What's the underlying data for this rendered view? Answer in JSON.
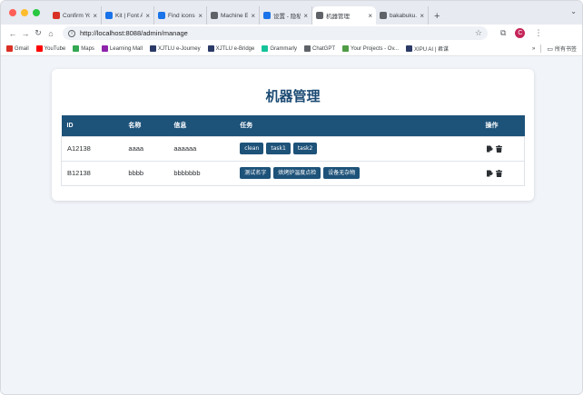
{
  "browser": {
    "tabs": [
      {
        "title": "Confirm Your I",
        "favicon": "gmail-icon",
        "color": "#d93025",
        "active": false
      },
      {
        "title": "Kit | Font Awe",
        "favicon": "fontawesome-icon",
        "color": "#1a73e8",
        "active": false
      },
      {
        "title": "Find icons wit",
        "favicon": "fontawesome-icon",
        "color": "#1a73e8",
        "active": false
      },
      {
        "title": "Machine Edit",
        "favicon": "globe-icon",
        "color": "#5f6368",
        "active": false
      },
      {
        "title": "设置 - 隐私和安",
        "favicon": "settings-icon",
        "color": "#1a73e8",
        "active": false
      },
      {
        "title": "机器管理",
        "favicon": "globe-icon",
        "color": "#5f6368",
        "active": true
      },
      {
        "title": "bakabuku.co",
        "favicon": "globe-icon",
        "color": "#5f6368",
        "active": false
      }
    ],
    "url": "http://localhost:8088/admin/manage",
    "profile_initial": "C",
    "bookmarks": [
      {
        "label": "Gmail",
        "icon": "gmail-icon",
        "color": "#d93025"
      },
      {
        "label": "YouTube",
        "icon": "youtube-icon",
        "color": "#ff0000"
      },
      {
        "label": "Maps",
        "icon": "maps-icon",
        "color": "#34a853"
      },
      {
        "label": "Learning Mall",
        "icon": "learning-mall-icon",
        "color": "#8e24aa"
      },
      {
        "label": "XJTLU e-Journey",
        "icon": "shield-icon",
        "color": "#2b3a67"
      },
      {
        "label": "XJTLU e-Bridge",
        "icon": "shield-icon",
        "color": "#2b3a67"
      },
      {
        "label": "Grammarly",
        "icon": "grammarly-icon",
        "color": "#15c39a"
      },
      {
        "label": "ChatGPT",
        "icon": "chatgpt-icon",
        "color": "#5f6368"
      },
      {
        "label": "Your Projects - Ov...",
        "icon": "overleaf-icon",
        "color": "#4f9c45"
      },
      {
        "label": "XIPU AI | 君谋",
        "icon": "shield-icon",
        "color": "#2b3a67"
      }
    ],
    "bookmarks_overflow": "»",
    "all_bookmarks_label": "所有书签"
  },
  "page": {
    "title": "机器管理",
    "table": {
      "headers": {
        "id": "ID",
        "name": "名称",
        "info": "信息",
        "tasks": "任务",
        "ops": "操作"
      },
      "rows": [
        {
          "id": "A12138",
          "name": "aaaa",
          "info": "aaaaaa",
          "tasks": [
            "clean",
            "task1",
            "task2"
          ]
        },
        {
          "id": "B12138",
          "name": "bbbb",
          "info": "bbbbbbb",
          "tasks": [
            "测试名字",
            "烘烤炉温度点检",
            "设备无杂物"
          ]
        }
      ]
    }
  }
}
